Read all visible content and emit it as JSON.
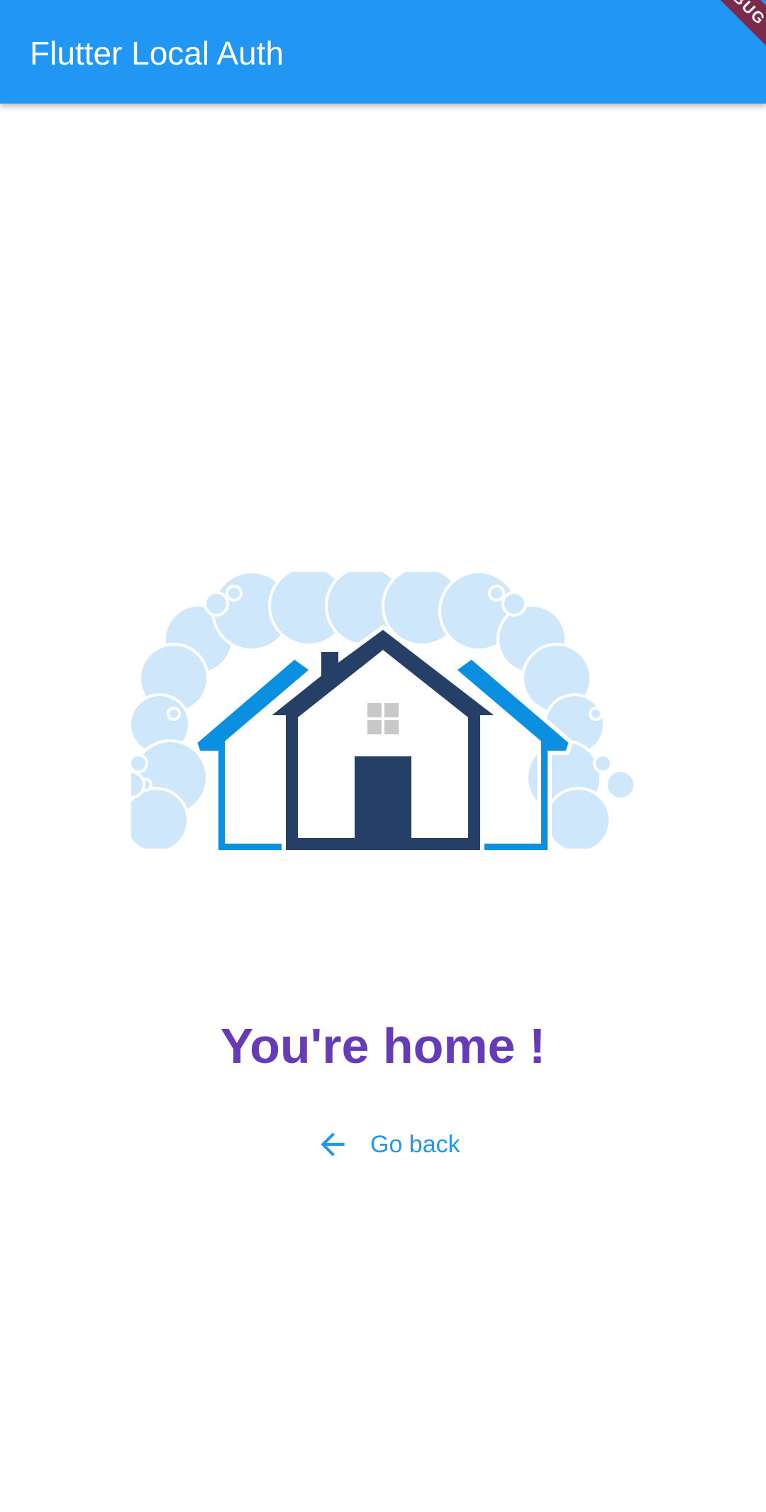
{
  "app_bar": {
    "title": "Flutter Local Auth",
    "banner_text": "DEBUG"
  },
  "main": {
    "illustration_icon": "house-with-bubbles-icon",
    "headline": "You're home !",
    "back_button": {
      "icon": "arrow-back-icon",
      "label": "Go back"
    }
  },
  "colors": {
    "app_bar": "#2196F3",
    "headline": "#673AB7",
    "button_text": "#2196F3",
    "house_dark": "#253F66",
    "house_light": "#0B8FE0",
    "bubbles": "#CFE7FA"
  }
}
